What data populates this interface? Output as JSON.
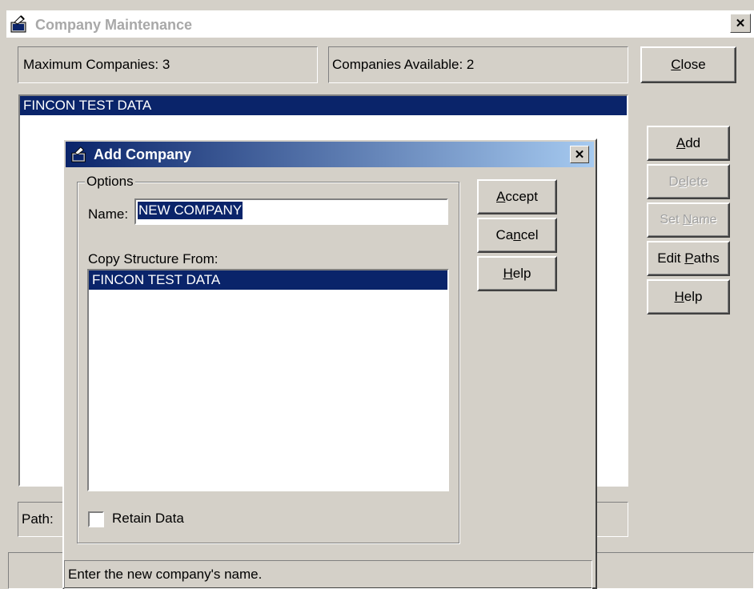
{
  "main_window": {
    "title": "Company Maintenance",
    "close_glyph": "✕",
    "max_companies": "Maximum Companies: 3",
    "companies_available": "Companies Available: 2",
    "company_list": [
      "FINCON TEST DATA"
    ],
    "path_label": "Path:",
    "buttons": {
      "close": {
        "pre": "",
        "u": "C",
        "post": "lose"
      },
      "add": {
        "pre": "",
        "u": "A",
        "post": "dd"
      },
      "delete": {
        "pre": "D",
        "u": "e",
        "post": "lete"
      },
      "set_name": {
        "pre": "Set ",
        "u": "N",
        "post": "ame"
      },
      "edit_paths": {
        "pre": "Edit ",
        "u": "P",
        "post": "aths"
      },
      "help": {
        "pre": "",
        "u": "H",
        "post": "elp"
      }
    }
  },
  "dialog": {
    "title": "Add Company",
    "close_glyph": "✕",
    "options_label": "Options",
    "name_label": "Name:",
    "name_value": "NEW COMPANY",
    "copy_label": "Copy Structure From:",
    "copy_list": [
      "FINCON TEST DATA"
    ],
    "retain_label": "Retain Data",
    "retain_checked": false,
    "status_text": "Enter the new company's name.",
    "buttons": {
      "accept": {
        "pre": "",
        "u": "A",
        "post": "ccept"
      },
      "cancel": {
        "pre": "Ca",
        "u": "n",
        "post": "cel"
      },
      "help": {
        "pre": "",
        "u": "H",
        "post": "elp"
      }
    }
  },
  "icons": {
    "app_icon": "window-app-icon",
    "dialog_icon": "dialog-app-icon"
  }
}
